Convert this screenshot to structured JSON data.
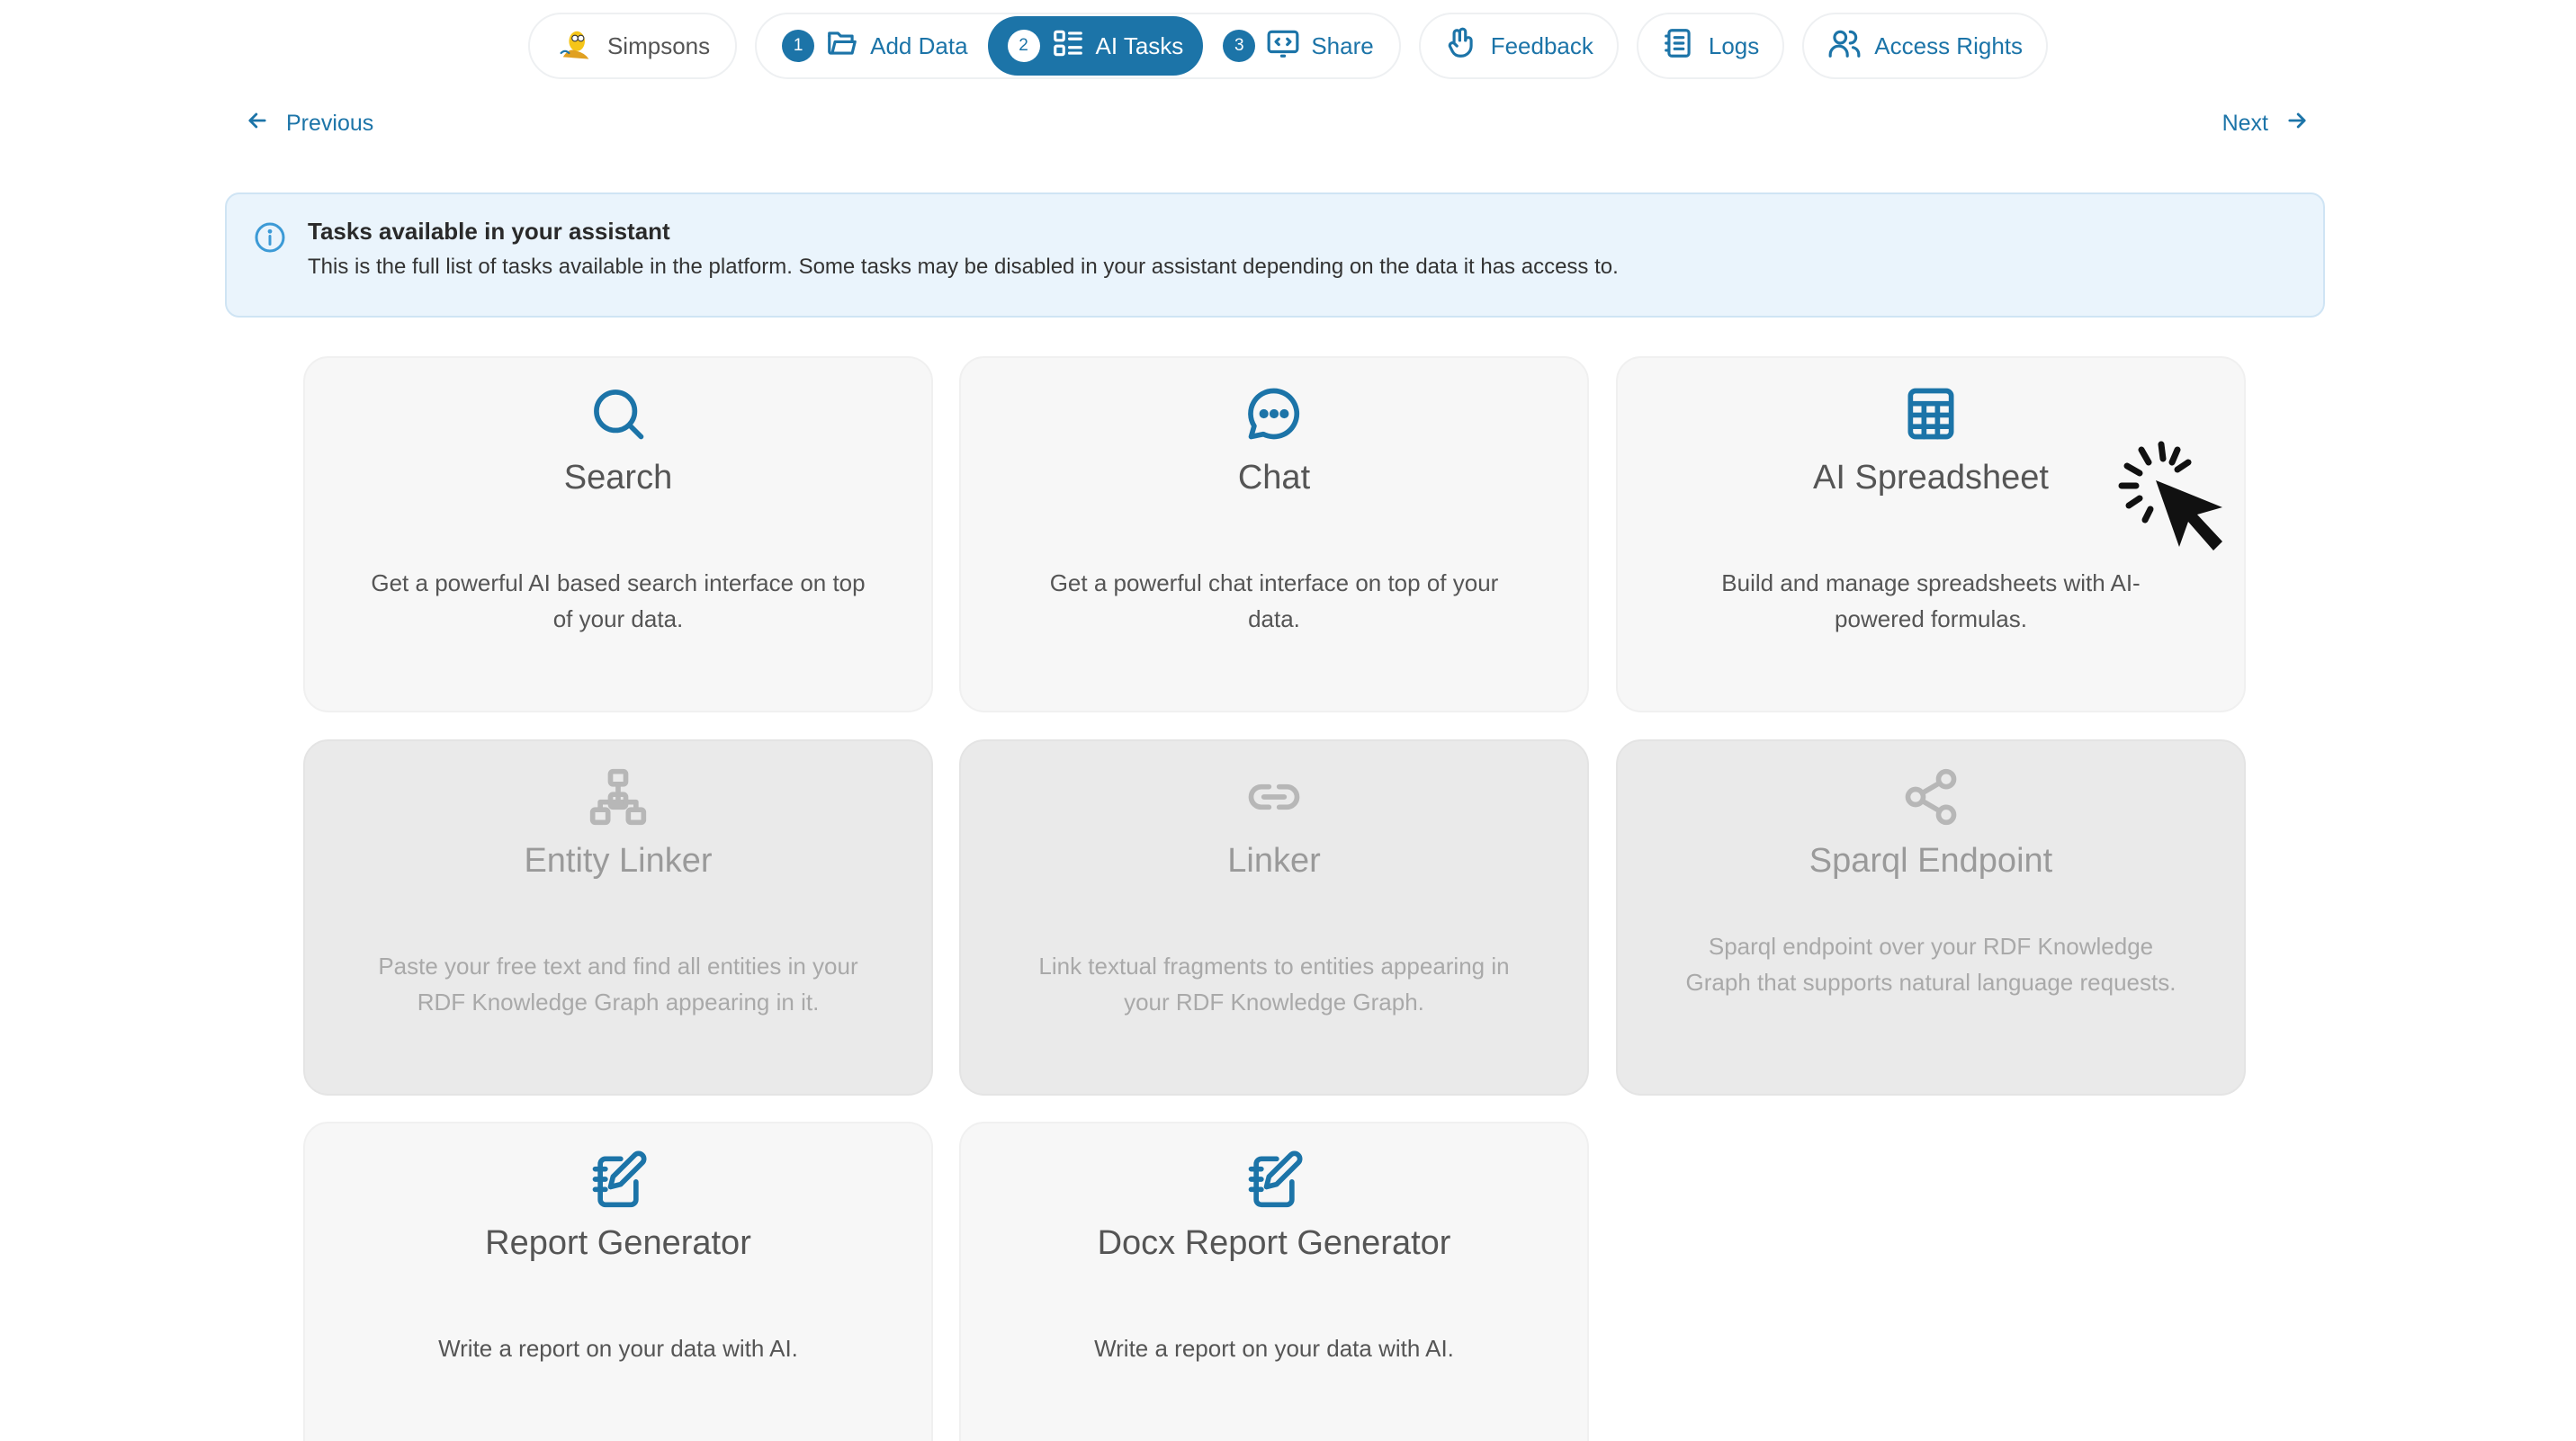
{
  "topnav": {
    "project": "Simpsons",
    "steps": [
      {
        "num": "1",
        "label": "Add Data"
      },
      {
        "num": "2",
        "label": "AI Tasks"
      },
      {
        "num": "3",
        "label": "Share"
      }
    ],
    "feedback": "Feedback",
    "logs": "Logs",
    "access": "Access Rights"
  },
  "nav": {
    "previous": "Previous",
    "next": "Next"
  },
  "banner": {
    "title": "Tasks available in your assistant",
    "text": "This is the full list of tasks available in the platform. Some tasks may be disabled in your assistant depending on the data it has access to."
  },
  "cards": [
    {
      "title": "Search",
      "desc": "Get a powerful AI based search interface on top of your data.",
      "icon": "search-icon"
    },
    {
      "title": "Chat",
      "desc": "Get a powerful chat interface on top of your data.",
      "icon": "chat-icon"
    },
    {
      "title": "AI Spreadsheet",
      "desc": "Build and manage spreadsheets with AI-powered formulas.",
      "icon": "spreadsheet-icon"
    },
    {
      "title": "Entity Linker",
      "desc": "Paste your free text and find all entities in your RDF Knowledge Graph appearing in it.",
      "icon": "hierarchy-icon"
    },
    {
      "title": "Linker",
      "desc": "Link textual fragments to entities appearing in your RDF Knowledge Graph.",
      "icon": "link-icon"
    },
    {
      "title": "Sparql Endpoint",
      "desc": "Sparql endpoint over your RDF Knowledge Graph that supports natural language requests.",
      "icon": "share-nodes-icon"
    },
    {
      "title": "Report Generator",
      "desc": "Write a report on your data with AI.",
      "icon": "notebook-pen-icon"
    },
    {
      "title": "Docx Report Generator",
      "desc": "Write a report on your data with AI.",
      "icon": "notebook-pen-icon"
    }
  ],
  "colors": {
    "accent": "#1c74a8",
    "banner_bg": "#eaf4fc",
    "disabled_bg": "#eaeaea"
  }
}
